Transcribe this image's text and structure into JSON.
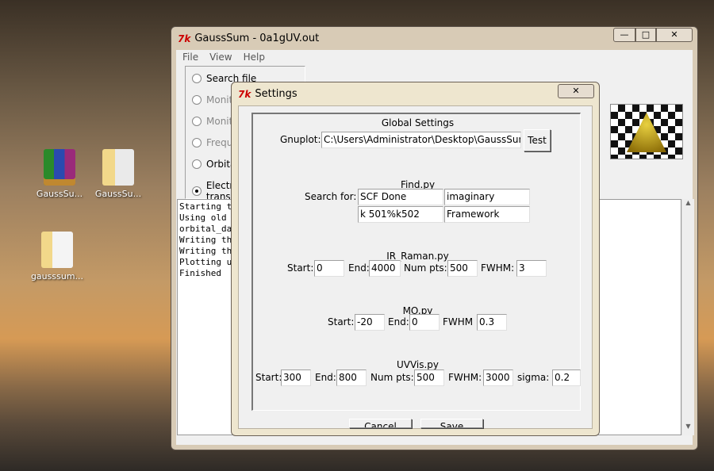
{
  "desktop": {
    "icons": [
      {
        "label": "GaussSu..."
      },
      {
        "label": "GaussSu..."
      },
      {
        "label": "gausssum..."
      }
    ]
  },
  "main": {
    "title": "GaussSum - 0a1gUV.out",
    "controls": {
      "minimize": "—",
      "maximize": "□",
      "close": "✕"
    },
    "menu": [
      "File",
      "View",
      "Help"
    ],
    "radios": [
      {
        "label": "Search file",
        "selected": false,
        "enabled": true
      },
      {
        "label": "Monitor SCF",
        "selected": false,
        "enabled": false
      },
      {
        "label": "Monitor geometry",
        "selected": false,
        "enabled": false
      },
      {
        "label": "Frequencies",
        "selected": false,
        "enabled": false
      },
      {
        "label": "Orbitals",
        "selected": false,
        "enabled": true
      },
      {
        "label": "Electronic transitions",
        "selected": true,
        "enabled": true
      }
    ],
    "log": [
      "Starting t",
      "Using old ",
      "orbital_da",
      "Writing th",
      "Writing th",
      "Plotting u",
      "Finished"
    ]
  },
  "settings": {
    "title": "Settings",
    "close": "✕",
    "global": {
      "heading": "Global Settings",
      "gnuplot_label": "Gnuplot:",
      "gnuplot_value": "C:\\Users\\Administrator\\Desktop\\GaussSum",
      "test": "Test"
    },
    "find": {
      "heading": "Find.py",
      "label": "Search for:",
      "terms": [
        "SCF Done",
        "imaginary",
        "k 501%k502",
        "Framework"
      ]
    },
    "ir": {
      "heading": "IR_Raman.py",
      "start_label": "Start:",
      "start": "0",
      "end_label": "End:",
      "end": "4000",
      "numpts_label": "Num pts:",
      "numpts": "500",
      "fwhm_label": "FWHM:",
      "fwhm": "3"
    },
    "mo": {
      "heading": "MO.py",
      "start_label": "Start:",
      "start": "-20",
      "end_label": "End:",
      "end": "0",
      "fwhm_label": "FWHM",
      "fwhm": "0.3"
    },
    "uvvis": {
      "heading": "UVVis.py",
      "start_label": "Start:",
      "start": "300",
      "end_label": "End:",
      "end": "800",
      "numpts_label": "Num pts:",
      "numpts": "500",
      "fwhm_label": "FWHM:",
      "fwhm": "3000",
      "sigma_label": "sigma:",
      "sigma": "0.2"
    },
    "cancel": "Cancel",
    "save": "Save"
  }
}
